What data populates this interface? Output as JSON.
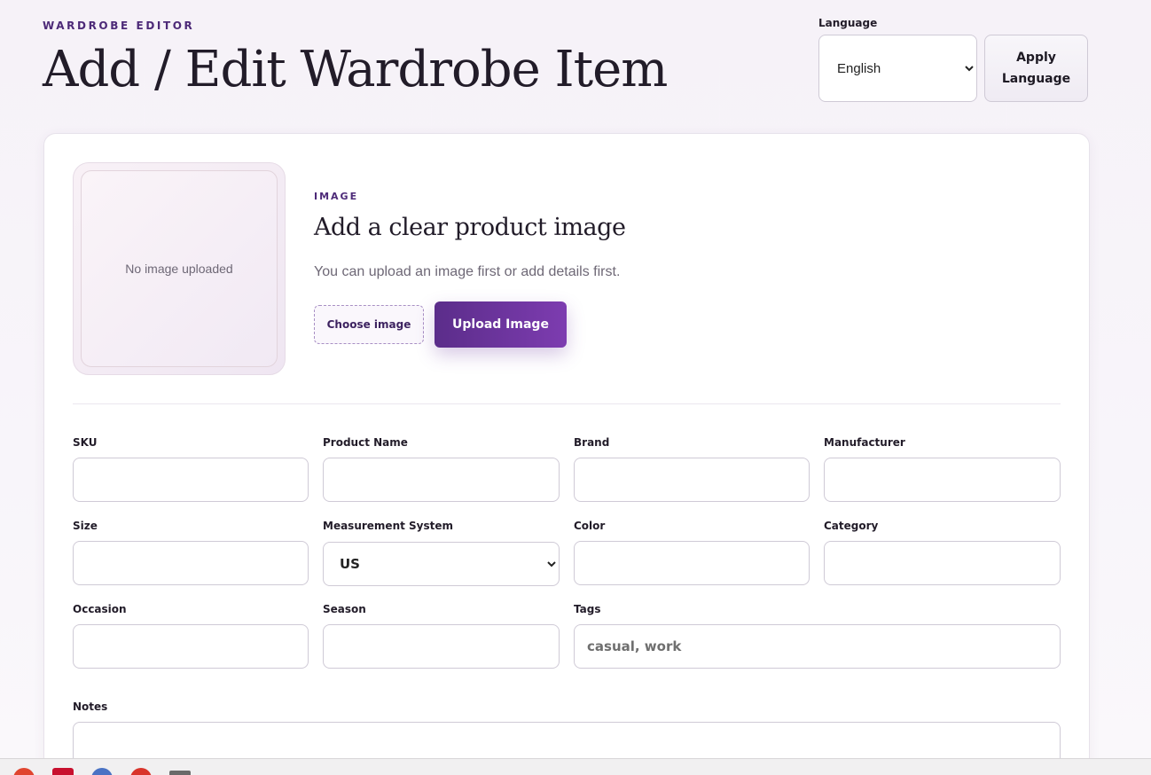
{
  "header": {
    "eyebrow": "WARDROBE EDITOR",
    "title": "Add / Edit Wardrobe Item"
  },
  "language": {
    "label": "Language",
    "selected": "English",
    "options": [
      "English"
    ],
    "apply_label": "Apply\nLanguage"
  },
  "image": {
    "preview_text": "No image uploaded",
    "eyebrow": "IMAGE",
    "title": "Add a clear product image",
    "description": "You can upload an image first or add details first.",
    "choose_label": "Choose image",
    "upload_label": "Upload Image"
  },
  "fields": {
    "sku": {
      "label": "SKU",
      "value": ""
    },
    "product_name": {
      "label": "Product Name",
      "value": ""
    },
    "brand": {
      "label": "Brand",
      "value": ""
    },
    "manufacturer": {
      "label": "Manufacturer",
      "value": ""
    },
    "size": {
      "label": "Size",
      "value": ""
    },
    "measurement_system": {
      "label": "Measurement System",
      "selected": "US",
      "options": [
        "US"
      ]
    },
    "color": {
      "label": "Color",
      "value": ""
    },
    "category": {
      "label": "Category",
      "value": ""
    },
    "occasion": {
      "label": "Occasion",
      "value": ""
    },
    "season": {
      "label": "Season",
      "value": ""
    },
    "tags": {
      "label": "Tags",
      "placeholder": "casual, work",
      "value": ""
    },
    "notes": {
      "label": "Notes",
      "value": ""
    }
  },
  "taskbar": {
    "icons": [
      "chrome-icon",
      "acrobat-icon",
      "browser-icon",
      "app-icon",
      "folder-icon"
    ],
    "colors": [
      "#e0452f",
      "#c8102e",
      "#4a72c4",
      "#d9342b",
      "#6a6a6a"
    ]
  }
}
